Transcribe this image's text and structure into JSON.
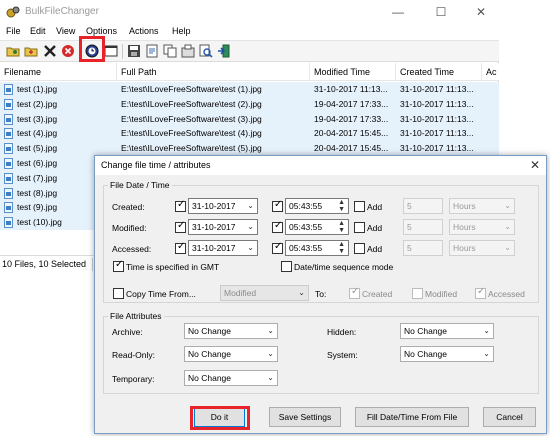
{
  "app": {
    "title": "BulkFileChanger"
  },
  "menu": [
    "File",
    "Edit",
    "View",
    "Options",
    "Actions",
    "Help"
  ],
  "table": {
    "columns": [
      "Filename",
      "Full Path",
      "Modified Time",
      "Created Time",
      "Ac"
    ],
    "rows": [
      [
        "test (1).jpg",
        "E:\\test\\ILoveFreeSoftware\\test (1).jpg",
        "31-10-2017 11:13...",
        "31-10-2017 11:13..."
      ],
      [
        "test (2).jpg",
        "E:\\test\\ILoveFreeSoftware\\test (2).jpg",
        "19-04-2017 17:33...",
        "31-10-2017 11:13..."
      ],
      [
        "test (3).jpg",
        "E:\\test\\ILoveFreeSoftware\\test (3).jpg",
        "19-04-2017 17:33...",
        "31-10-2017 11:13..."
      ],
      [
        "test (4).jpg",
        "E:\\test\\ILoveFreeSoftware\\test (4).jpg",
        "20-04-2017 15:45...",
        "31-10-2017 11:13..."
      ],
      [
        "test (5).jpg",
        "E:\\test\\ILoveFreeSoftware\\test (5).jpg",
        "20-04-2017 15:45...",
        "31-10-2017 11:13..."
      ],
      [
        "test (6).jpg",
        "",
        "",
        ""
      ],
      [
        "test (7).jpg",
        "",
        "",
        ""
      ],
      [
        "test (8).jpg",
        "",
        "",
        ""
      ],
      [
        "test (9).jpg",
        "",
        "",
        ""
      ],
      [
        "test (10).jpg",
        "",
        "",
        ""
      ]
    ]
  },
  "status": {
    "text": "10 Files, 10 Selected"
  },
  "dialog": {
    "title": "Change file time / attributes",
    "date_group": "File Date / Time",
    "rows": [
      {
        "label": "Created:",
        "date": "31-10-2017",
        "time": "05:43:55",
        "add_label": "Add",
        "add_value": "5",
        "unit": "Hours"
      },
      {
        "label": "Modified:",
        "date": "31-10-2017",
        "time": "05:43:55",
        "add_label": "Add",
        "add_value": "5",
        "unit": "Hours"
      },
      {
        "label": "Accessed:",
        "date": "31-10-2017",
        "time": "05:43:55",
        "add_label": "Add",
        "add_value": "5",
        "unit": "Hours"
      }
    ],
    "gmt_label": "Time is specified in GMT",
    "sequence_label": "Date/time sequence mode",
    "copy_label": "Copy Time From...",
    "copy_value": "Modified",
    "to_label": "To:",
    "to_created": "Created",
    "to_modified": "Modified",
    "to_accessed": "Accessed",
    "attr_group": "File Attributes",
    "attrs": {
      "archive_label": "Archive:",
      "archive_value": "No Change",
      "readonly_label": "Read-Only:",
      "readonly_value": "No Change",
      "temporary_label": "Temporary:",
      "temporary_value": "No Change",
      "hidden_label": "Hidden:",
      "hidden_value": "No Change",
      "system_label": "System:",
      "system_value": "No Change"
    },
    "buttons": {
      "doit": "Do it",
      "save": "Save Settings",
      "fill": "Fill Date/Time From File",
      "cancel": "Cancel"
    }
  },
  "colors": {
    "highlight": "#e8232a",
    "row_selected": "#e5f1fb",
    "dialog_bg": "#f0f0f0"
  },
  "icons": [
    "open-icon",
    "open-folder-icon",
    "delete-icon",
    "stop-icon",
    "change-time-icon",
    "window-icon",
    "save-icon",
    "refresh-icon",
    "copy-icon",
    "properties-icon",
    "search-icon",
    "exit-icon"
  ]
}
